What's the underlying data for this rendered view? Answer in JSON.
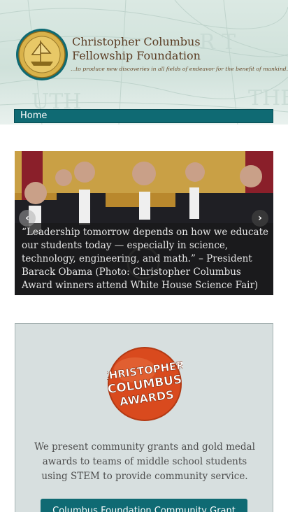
{
  "header": {
    "org_name_line1": "Christopher Columbus",
    "org_name_line2": "Fellowship Foundation",
    "tagline": "...to produce new discoveries in all fields of endeavor for the benefit of mankind.",
    "seal_icon": "foundation-seal-icon",
    "colors": {
      "nav_bg": "#0f6a73",
      "brand_text": "#5a3b22"
    }
  },
  "nav": {
    "items": [
      {
        "label": "Home"
      }
    ]
  },
  "slider": {
    "caption": "“Leadership tomorrow depends on how we educate our students today — especially in science, technology, engineering, and math.” – President Barack Obama (Photo: Christopher Columbus Award winners attend White House Science Fair)",
    "prev_icon": "chevron-left-icon",
    "next_icon": "chevron-right-icon",
    "prev_glyph": "‹",
    "next_glyph": "›"
  },
  "info": {
    "logo_text_line1": "CHRISTOPHER",
    "logo_text_line2": "COLUMBUS",
    "logo_text_line3": "AWARDS",
    "description": "We present community grants and gold medal awards to teams of middle school students using STEM to provide community service.",
    "button_label": "Columbus Foundation Community Grant"
  }
}
